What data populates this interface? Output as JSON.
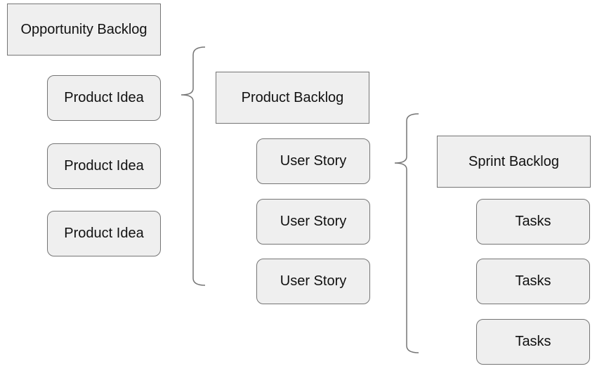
{
  "diagram": {
    "levels": [
      {
        "header": "Opportunity Backlog",
        "items": [
          "Product Idea",
          "Product Idea",
          "Product Idea"
        ]
      },
      {
        "header": "Product Backlog",
        "items": [
          "User Story",
          "User Story",
          "User Story"
        ]
      },
      {
        "header": "Sprint Backlog",
        "items": [
          "Tasks",
          "Tasks",
          "Tasks"
        ]
      }
    ],
    "colors": {
      "box_fill": "#efefef",
      "box_border": "#757575",
      "text": "#111111"
    }
  }
}
